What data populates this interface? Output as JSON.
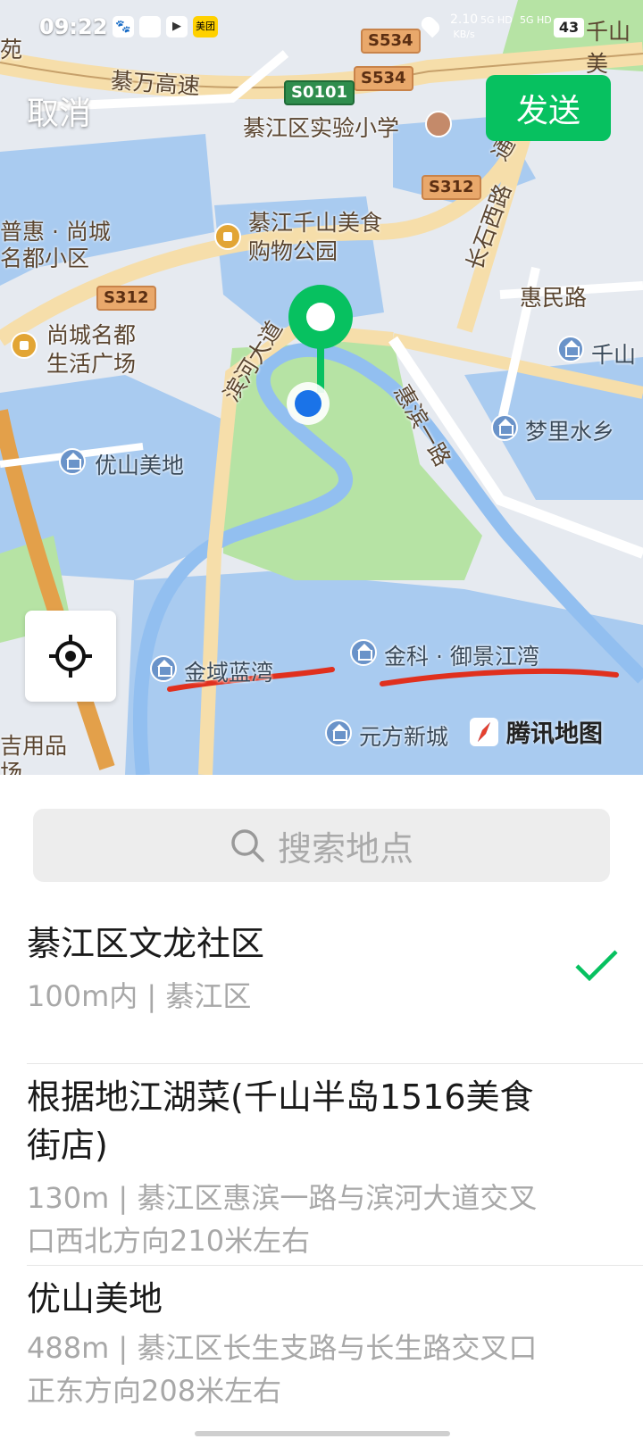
{
  "status": {
    "time": "09:22",
    "net_speed_value": "2.10",
    "net_speed_unit": "KB/s",
    "sim1": "5G HD",
    "sim2": "5G HD",
    "battery": "43",
    "app_badge": "美团",
    "right_edge_label": "千山美"
  },
  "header": {
    "cancel": "取消",
    "send": "发送"
  },
  "map": {
    "labels": {
      "edge_tl": "苑",
      "expressway": "綦万高速",
      "school": "綦江区实验小学",
      "mall_l1": "綦江千山美食",
      "mall_l2": "购物公园",
      "huimin": "惠民路",
      "changshi": "长石西路",
      "tong": "通",
      "binhe": "滨河大道",
      "huibin": "惠滨一路",
      "qianshan": "千山",
      "mengli": "梦里水乡",
      "puhui_l1": "普惠 · 尚城",
      "puhui_l2": "名都小区",
      "shangcheng_l1": "尚城名都",
      "shangcheng_l2": "生活广场",
      "youshan": "优山美地",
      "jinyu": "金域蓝湾",
      "jinke": "金科 · 御景江湾",
      "yuanfang": "元方新城",
      "left_edge_l1": "吉用品",
      "left_edge_l2": "场"
    },
    "shields": {
      "s534a": "S534",
      "s534b": "S534",
      "s0101": "S0101",
      "s312a": "S312",
      "s312b": "S312"
    },
    "brand": "腾讯地图",
    "colors": {
      "pin": "#07c160",
      "dot": "#1a73e8",
      "water": "#a9cbf0",
      "park": "#b6e3a4",
      "road": "#f6deaa",
      "marker_line": "#e0301e"
    }
  },
  "search": {
    "placeholder": "搜索地点"
  },
  "results": [
    {
      "title": "綦江区文龙社区",
      "subtitle": "100m内 | 綦江区",
      "selected": true
    },
    {
      "title": "根据地江湖菜(千山半岛1516美食街店)",
      "subtitle": "130m | 綦江区惠滨一路与滨河大道交叉口西北方向210米左右",
      "selected": false
    },
    {
      "title": "优山美地",
      "subtitle": "488m | 綦江区长生支路与长生路交叉口正东方向208米左右",
      "selected": false
    }
  ]
}
